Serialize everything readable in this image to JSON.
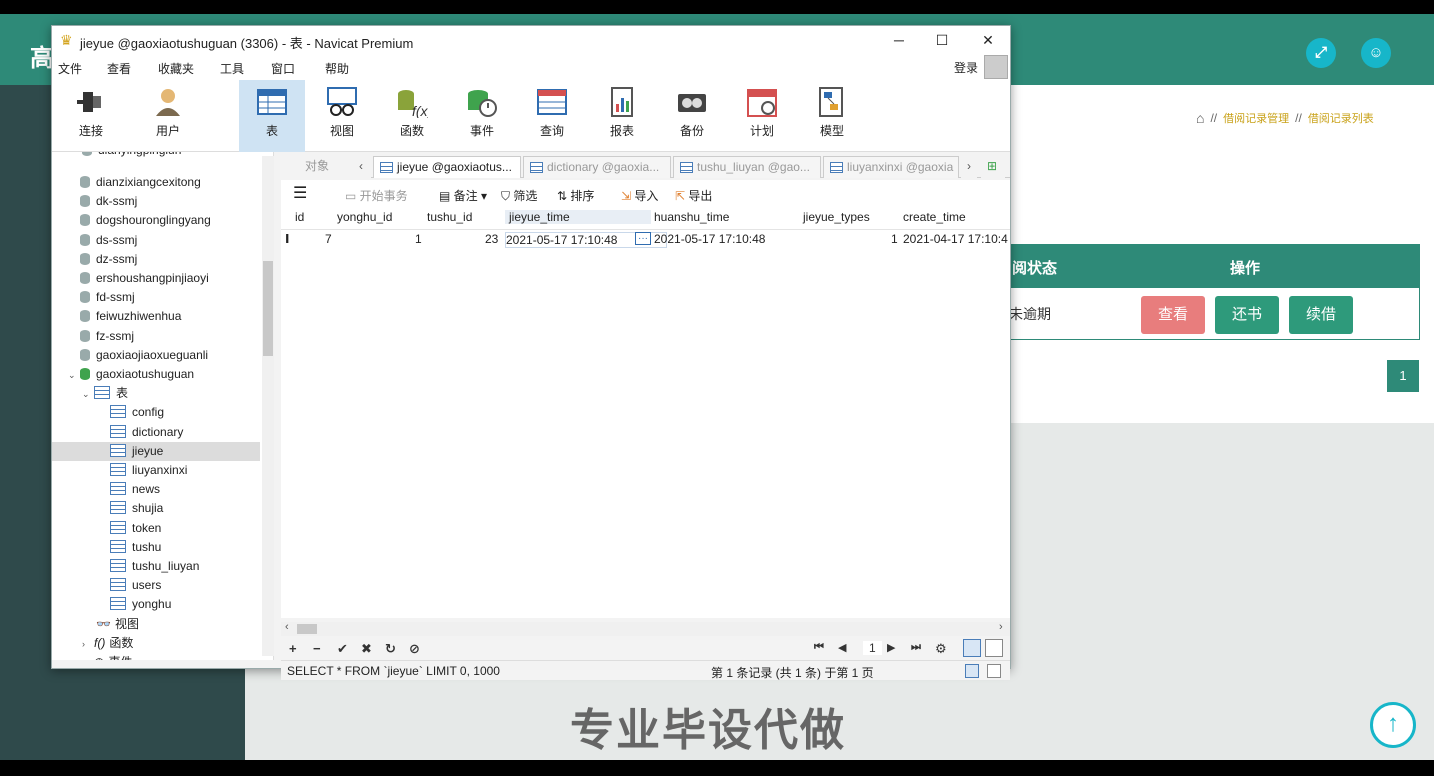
{
  "background_app": {
    "logo_char": "高",
    "icons": [
      "expand-icon",
      "user-icon"
    ],
    "breadcrumb": {
      "sep": "//",
      "crumbs": [
        "借阅记录管理",
        "借阅记录列表"
      ]
    },
    "table_headers": [
      "阅状态",
      "操作"
    ],
    "row_status": "未逾期",
    "actions": [
      "查看",
      "还书",
      "续借"
    ],
    "action_colors": [
      "#e87d7d",
      "#2e9a7b",
      "#2e9a7b"
    ],
    "page": "1",
    "watermark": "专业毕设代做",
    "up_arrow": "↑"
  },
  "window": {
    "title": "jieyue @gaoxiaotushuguan (3306) - 表 - Navicat Premium",
    "controls": [
      "─",
      "☐",
      "✕"
    ],
    "menu": [
      "文件",
      "查看",
      "收藏夹",
      "工具",
      "窗口",
      "帮助"
    ],
    "login": "登录",
    "toolbar": [
      "连接",
      "用户",
      "表",
      "视图",
      "函数",
      "事件",
      "查询",
      "报表",
      "备份",
      "计划",
      "模型"
    ]
  },
  "tree": {
    "partial_top": "dianyingpinglun",
    "databases": [
      "dianzixiangcexitong",
      "dk-ssmj",
      "dogshouronglingyang",
      "ds-ssmj",
      "dz-ssmj",
      "ershoushangpinjiaoyi",
      "fd-ssmj",
      "feiwuzhiwenhua",
      "fz-ssmj",
      "gaoxiaojiaoxueguanli",
      "gaoxiaotushuguan"
    ],
    "tables_label": "表",
    "tables": [
      "config",
      "dictionary",
      "jieyue",
      "liuyanxinxi",
      "news",
      "shujia",
      "token",
      "tushu",
      "tushu_liuyan",
      "users",
      "yonghu"
    ],
    "views_label": "视图",
    "functions_label": "函数",
    "events_label": "事件"
  },
  "tabs": {
    "objects": "对象",
    "open": [
      "jieyue @gaoxiaotus...",
      "dictionary @gaoxia...",
      "tushu_liuyan @gao...",
      "liuyanxinxi @gaoxia"
    ]
  },
  "grid_toolbar": [
    "开始事务",
    "备注",
    "筛选",
    "排序",
    "导入",
    "导出"
  ],
  "grid": {
    "columns": [
      "id",
      "yonghu_id",
      "tushu_id",
      "jieyue_time",
      "huanshu_time",
      "jieyue_types",
      "create_time"
    ],
    "row": [
      "7",
      "1",
      "23",
      "2021-05-17 17:10:48",
      "2021-05-17 17:10:48",
      "1",
      "2021-04-17 17:10:4"
    ],
    "ellipsis": "···"
  },
  "bottom_controls": [
    "+",
    "−",
    "✔",
    "✖",
    "↻",
    "⊘"
  ],
  "pager": {
    "first": "⏮",
    "prev": "◀",
    "page": "1",
    "next": "▶",
    "last": "⏭",
    "settings": "⚙"
  },
  "status": {
    "sql": "SELECT * FROM `jieyue` LIMIT 0, 1000",
    "records": "第 1 条记录 (共 1 条) 于第 1 页"
  }
}
